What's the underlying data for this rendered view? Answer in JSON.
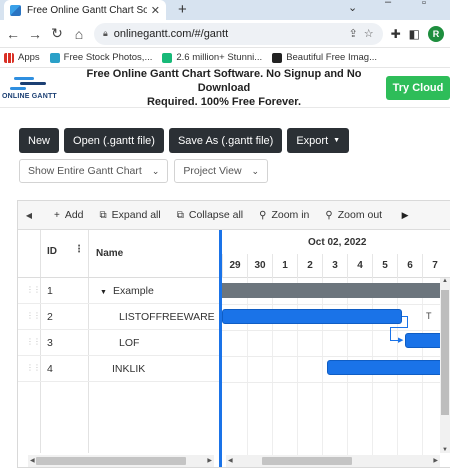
{
  "browser": {
    "tab_title": "Free Online Gantt Chart Software",
    "url": "onlinegantt.com/#/gantt",
    "profile_initial": "R",
    "bookmarks": [
      "Apps",
      "Free Stock Photos,...",
      "2.6 million+ Stunni...",
      "Beautiful Free Imag..."
    ]
  },
  "site": {
    "logo_text": "ONLINE GANTT",
    "tagline_line1": "Free Online Gantt Chart Software. No Signup and No Download",
    "tagline_line2": "Required. 100% Free Forever.",
    "cta": "Try Cloud"
  },
  "actions": {
    "new": "New",
    "open": "Open (.gantt file)",
    "save_as": "Save As (.gantt file)",
    "export": "Export"
  },
  "filters": {
    "view_range": "Show Entire Gantt Chart",
    "view_mode": "Project View"
  },
  "gantt_toolbar": {
    "add": "Add",
    "expand_all": "Expand all",
    "collapse_all": "Collapse all",
    "zoom_in": "Zoom in",
    "zoom_out": "Zoom out"
  },
  "grid": {
    "col_id": "ID",
    "col_name": "Name",
    "rows": [
      {
        "id": "1",
        "name": "Example",
        "type": "summary"
      },
      {
        "id": "2",
        "name": "LISTOFFREEWARE",
        "type": "task"
      },
      {
        "id": "3",
        "name": "LOF",
        "type": "task"
      },
      {
        "id": "4",
        "name": "INKLIK",
        "type": "task"
      }
    ]
  },
  "timeline": {
    "month_label": "Oct 02, 2022",
    "days": [
      "29",
      "30",
      "1",
      "2",
      "3",
      "4",
      "5",
      "6",
      "7"
    ],
    "bar_label_row2": "T"
  },
  "colors": {
    "accent": "#1a73e8",
    "dark_button": "#2b3035",
    "cta_green": "#2ebd59",
    "summary_bar": "#6c757d"
  }
}
